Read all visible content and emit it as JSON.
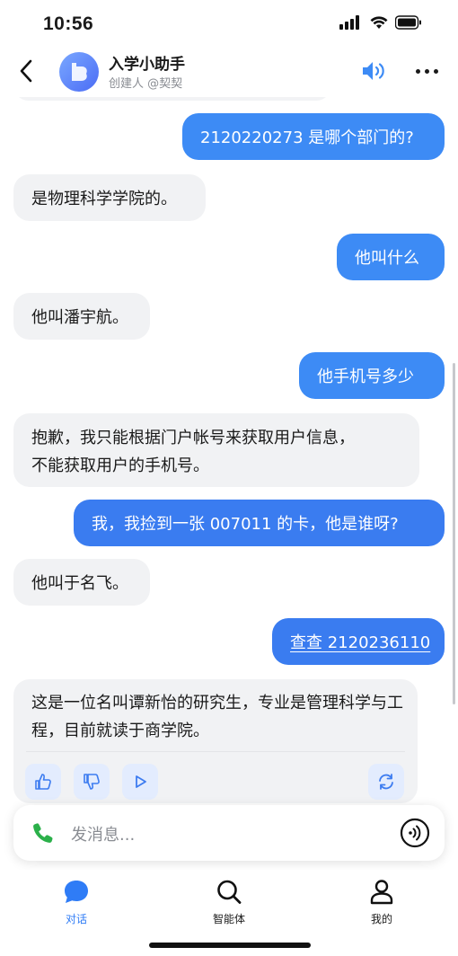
{
  "status_bar": {
    "time": "10:56"
  },
  "header": {
    "bot_name": "入学小助手",
    "creator": "创建人 @契契"
  },
  "messages": [
    {
      "role": "user",
      "text": "2120220273 是哪个部门的?"
    },
    {
      "role": "bot",
      "text": "是物理科学学院的。"
    },
    {
      "role": "user",
      "text": "他叫什么"
    },
    {
      "role": "bot",
      "text": "他叫潘宇航。"
    },
    {
      "role": "user",
      "text": "他手机号多少"
    },
    {
      "role": "bot",
      "line1": "抱歉，我只能根据门户帐号来获取用户信息，",
      "line2": "不能获取用户的手机号。"
    },
    {
      "role": "user",
      "text": "我，我捡到一张 007011 的卡，他是谁呀?"
    },
    {
      "role": "bot",
      "text": "他叫于名飞。"
    },
    {
      "role": "user",
      "text": "查查 2120236110"
    },
    {
      "role": "bot",
      "text": "这是一位名叫谭新怡的研究生，专业是管理科学与工程，目前就读于商学院。"
    }
  ],
  "input": {
    "placeholder": "发消息..."
  },
  "tabs": [
    {
      "label": "对话",
      "active": true
    },
    {
      "label": "智能体",
      "active": false
    },
    {
      "label": "我的",
      "active": false
    }
  ],
  "colors": {
    "accent": "#3d8bf5",
    "bubble_bot": "#f1f2f4",
    "phone": "#2bb04a"
  }
}
